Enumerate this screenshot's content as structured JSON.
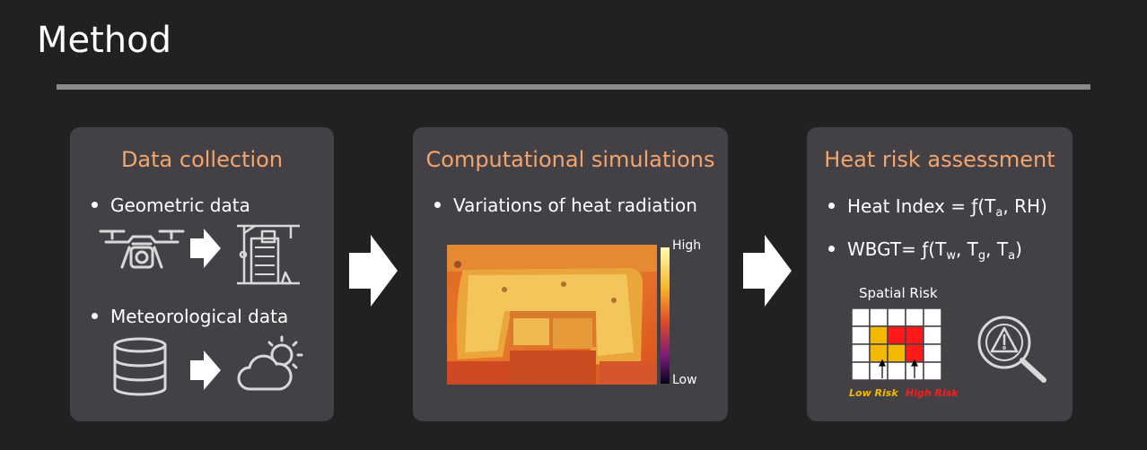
{
  "slide": {
    "title": "Method"
  },
  "panels": [
    {
      "title": "Data collection",
      "bullets": [
        "Geometric data",
        "Meteorological data"
      ]
    },
    {
      "title": "Computational simulations",
      "bullets": [
        "Variations of heat radiation"
      ],
      "scale": {
        "high": "High",
        "low": "Low"
      }
    },
    {
      "title": "Heat risk assessment",
      "heat_index": {
        "text": "Heat Index = ƒ(T",
        "sub1": "a",
        "mid": ", RH)"
      },
      "wbgt": {
        "text": "WBGT= ƒ(T",
        "sub1": "w",
        "c1": ", T",
        "sub2": "g",
        "c2": ", T",
        "sub3": "a",
        "end": ")"
      },
      "spatial_risk": {
        "label": "Spatial Risk",
        "low": "Low Risk",
        "high": "High Risk"
      }
    }
  ],
  "icons": [
    "drone-icon",
    "construction-icon",
    "database-icon",
    "weather-icon",
    "search-warning-icon"
  ],
  "colors": {
    "accent": "#f4a56c",
    "panel": "#444146",
    "background": "#222121",
    "low_risk": "#f5b800",
    "high_risk": "#ff1a1a"
  }
}
